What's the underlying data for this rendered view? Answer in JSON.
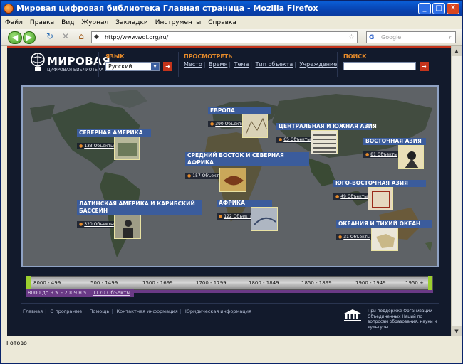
{
  "browser": {
    "title": "Мировая цифровая библиотека Главная страница - Mozilla Firefox",
    "menu": [
      "Файл",
      "Правка",
      "Вид",
      "Журнал",
      "Закладки",
      "Инструменты",
      "Справка"
    ],
    "url": "http://www.wdl.org/ru/",
    "search_placeholder": "Google",
    "status": "Готово"
  },
  "site": {
    "logo_title": "МИРОВАЯ",
    "logo_subtitle": "ЦИФРОВАЯ БИБЛИОТЕКА",
    "language_label": "ЯЗЫК",
    "language_value": "Русский",
    "browse_label": "ПРОСМОТРЕТЬ",
    "browse_links": [
      "Место",
      "Время",
      "Тема",
      "Тип объекта",
      "Учреждение"
    ],
    "search_label": "ПОИСК"
  },
  "regions": [
    {
      "title": "ЕВРОПА",
      "count": "390 Объекты"
    },
    {
      "title": "СЕВЕРНАЯ АМЕРИКА",
      "count": "133 Объекты"
    },
    {
      "title": "ЦЕНТРАЛЬНАЯ И ЮЖНАЯ АЗИЯ",
      "count": "65 Объекты"
    },
    {
      "title": "ВОСТОЧНАЯ АЗИЯ",
      "count": "81 Объекты"
    },
    {
      "title": "СРЕДНИЙ ВОСТОК И СЕВЕРНАЯ АФРИКА",
      "count": "157 Объекты"
    },
    {
      "title": "ЮГО-ВОСТОЧНАЯ АЗИЯ",
      "count": "49 Объекты"
    },
    {
      "title": "ЛАТИНСКАЯ АМЕРИКА И КАРИБСКИЙ БАССЕЙН",
      "count": "320 Объекты"
    },
    {
      "title": "АФРИКА",
      "count": "122 Объекты"
    },
    {
      "title": "ОКЕАНИЯ И ТИХИЙ ОКЕАН",
      "count": "31 Объекты"
    }
  ],
  "timeline": {
    "labels": [
      "8000 - 499",
      "500 - 1499",
      "1500 - 1699",
      "1700 - 1799",
      "1800 - 1849",
      "1850 - 1899",
      "1900 - 1949",
      "1950 +"
    ],
    "info_text": "8000 до н.э. - 2009 н.э. |",
    "info_link": "1170 Объекты"
  },
  "footer": {
    "links": [
      "Главная",
      "О программе",
      "Помощь",
      "Контактная информация",
      "Юридическая информация"
    ],
    "unesco_text": "При поддержке Организации Объединенных Наций по вопросам образования, науки и культуры"
  },
  "colors": {
    "page_bg": "#121a2c",
    "accent_red": "#c4341b",
    "label_orange": "#e58a2a",
    "region_blue": "#3b5c9c",
    "timeline_purple": "#6a3a86",
    "timeline_green": "#9ccf2f"
  }
}
